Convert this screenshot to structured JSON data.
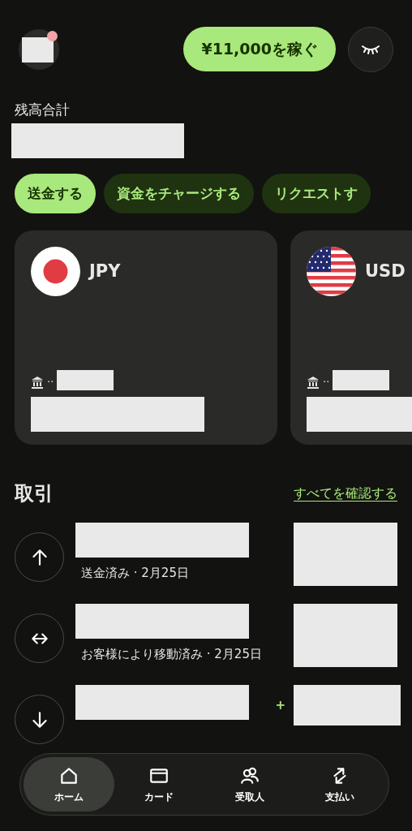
{
  "header": {
    "has_notification": true,
    "earn_button": "¥11,000を稼ぐ"
  },
  "balance": {
    "label": "残高合計"
  },
  "actions": [
    {
      "label": "送金する",
      "selected": true
    },
    {
      "label": "資金をチャージする",
      "selected": false
    },
    {
      "label": "リクエストす",
      "selected": false
    }
  ],
  "accounts": [
    {
      "kind": "jp",
      "currency": "JPY",
      "account_dots": "··"
    },
    {
      "kind": "us",
      "currency": "USD",
      "account_dots": "··"
    }
  ],
  "transactions": {
    "title": "取引",
    "see_all": "すべてを確認する",
    "items": [
      {
        "kind": "sent",
        "subtitle": "送金済み · 2月25日"
      },
      {
        "kind": "moved",
        "subtitle": "お客様により移動済み · 2月25日"
      },
      {
        "kind": "received",
        "amount_prefix": "+"
      }
    ]
  },
  "nav": [
    {
      "kind": "home",
      "label": "ホーム",
      "selected": true
    },
    {
      "kind": "card",
      "label": "カード",
      "selected": false
    },
    {
      "kind": "people",
      "label": "受取人",
      "selected": false
    },
    {
      "kind": "pay",
      "label": "支払い",
      "selected": false
    }
  ]
}
